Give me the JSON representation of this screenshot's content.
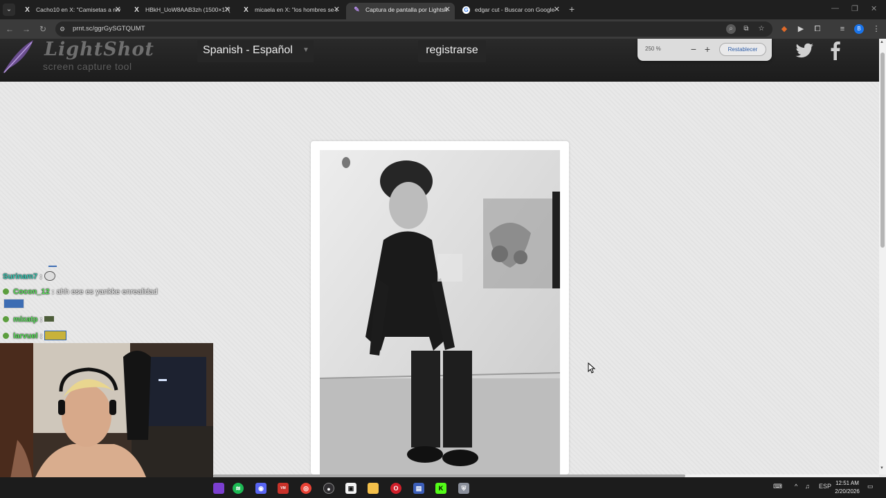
{
  "browser": {
    "tabs": [
      {
        "label": "Cacho10 en X: \"Camisetas a niv",
        "icon": "x-logo-icon",
        "active": false
      },
      {
        "label": "HBkH_UoW8AAB3zh (1500×17(",
        "icon": "x-logo-icon",
        "active": false
      },
      {
        "label": "micaela en X: \"los hombres se t",
        "icon": "x-logo-icon",
        "active": false
      },
      {
        "label": "Captura de pantalla por Lightsh",
        "icon": "feather-icon",
        "active": true
      },
      {
        "label": "edgar cut - Buscar con Google",
        "icon": "google-icon",
        "active": false
      }
    ],
    "new_tab_symbol": "+",
    "url": "prnt.sc/ggrGySGTQUMT",
    "profile_initial": "B"
  },
  "zoom_popup": {
    "value": "250 %",
    "minus": "−",
    "plus": "+",
    "reset_label": "Restablecer"
  },
  "lightshot": {
    "logo": "LightShot",
    "tagline": "screen capture tool",
    "language": "Spanish - Español",
    "register_label": "registrarse",
    "social": [
      "twitter-icon",
      "facebook-icon"
    ]
  },
  "chat": [
    {
      "user": "Surinam7",
      "message": "",
      "color": "#35c9b4"
    },
    {
      "user": "Cocon_12",
      "message": "ahh ese es yankke enrealidad",
      "color": "#5ce05c"
    },
    {
      "user": "mixatp",
      "message": "",
      "color": "#5ce05c"
    },
    {
      "user": "larvuel",
      "message": "",
      "color": "#5ce05c"
    }
  ],
  "taskbar": {
    "apps": [
      "spotify-icon",
      "discord-icon",
      "voicemeeter-icon",
      "chrome-icon",
      "obs-icon",
      "roblox-icon",
      "file-explorer-icon",
      "opera-icon",
      "app-icon",
      "kick-icon",
      "shield-icon"
    ],
    "tray": {
      "language": "ESP",
      "time": "12:51 AM",
      "date": "2/20/2026"
    }
  }
}
